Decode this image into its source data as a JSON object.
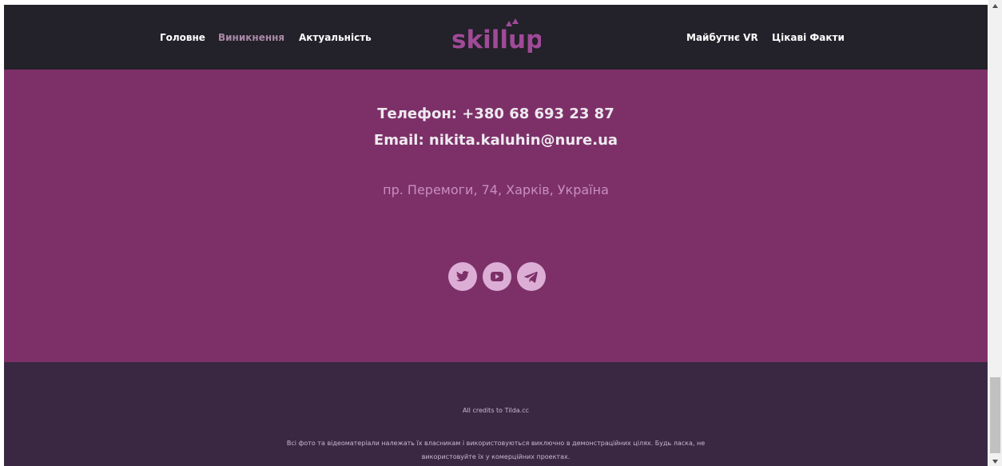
{
  "nav": {
    "left": [
      "Головне",
      "Виникнення",
      "Актуальність"
    ],
    "right": [
      "Майбутнє VR",
      "Цікаві Факти"
    ],
    "logo_text": "skillup"
  },
  "contact": {
    "phone": "Телефон: +380 68 693 23 87",
    "email": "Email: nikita.kaluhin@nure.ua",
    "address": "пр. Перемоги, 74, Харків, Україна",
    "socials": [
      "twitter-icon",
      "youtube-icon",
      "telegram-icon"
    ]
  },
  "footer": {
    "credits": "All credits to Tilda.cc",
    "disclaimer": "Всі фото та відеоматеріали належать їх власникам і використовуються виключно в демонстраційних цілях. Будь ласка, не використовуйте їх у комерційних проектах."
  },
  "colors": {
    "header_bg": "#232129",
    "contact_bg": "#7d3068",
    "footer_bg": "#3a2843",
    "logo": "#a04a98",
    "icon_circle": "#dcaed6"
  }
}
